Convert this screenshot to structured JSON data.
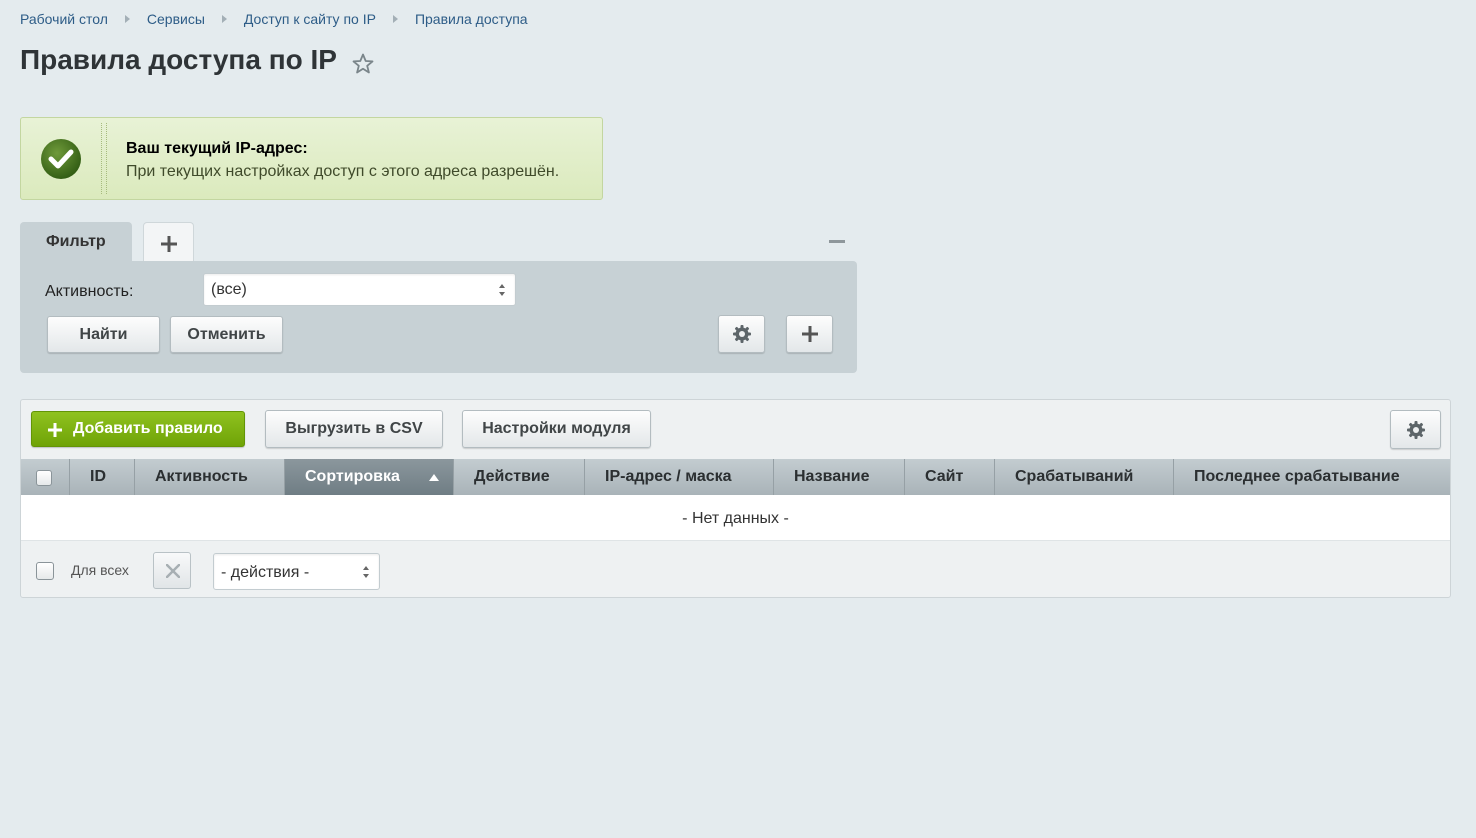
{
  "breadcrumb": [
    "Рабочий стол",
    "Сервисы",
    "Доступ к сайту по IP",
    "Правила доступа"
  ],
  "page_title": "Правила доступа по IP",
  "notice": {
    "title": "Ваш текущий IP-адрес:",
    "text": "При текущих настройках доступ с этого адреса разрешён."
  },
  "filter": {
    "tab_label": "Фильтр",
    "activity_label": "Активность:",
    "activity_value": "(все)",
    "find_label": "Найти",
    "cancel_label": "Отменить"
  },
  "toolbar": {
    "add_rule_label": "Добавить правило",
    "export_csv_label": "Выгрузить в CSV",
    "module_settings_label": "Настройки модуля"
  },
  "table": {
    "columns": [
      "ID",
      "Активность",
      "Сортировка",
      "Действие",
      "IP-адрес / маска",
      "Название",
      "Сайт",
      "Срабатываний",
      "Последнее срабатывание"
    ],
    "sorted_column": "Сортировка",
    "empty_text": "- Нет данных -"
  },
  "footer": {
    "for_all_label": "Для всех",
    "actions_value": "- действия -"
  },
  "colors": {
    "accent_green": "#7bb00f",
    "link": "#2d5c87",
    "background": "#e4ebee"
  }
}
